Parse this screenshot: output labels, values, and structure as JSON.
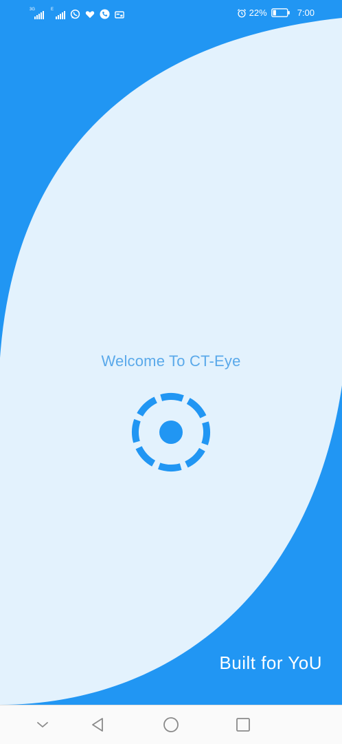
{
  "status_bar": {
    "network_1_label": "3G",
    "network_2_label": "E",
    "battery_percent": "22%",
    "time": "7:00",
    "battery_level": 0.22,
    "icons": [
      "signal-icon",
      "signal-icon",
      "whatsapp-icon",
      "heart-icon",
      "phone-icon",
      "card-icon",
      "alarm-icon",
      "battery-icon"
    ]
  },
  "splash": {
    "welcome_text": "Welcome To CT-Eye",
    "tagline": "Built for YoU",
    "logo_icon": "eye-target-icon"
  },
  "navigation": {
    "buttons": [
      "collapse-icon",
      "back-icon",
      "home-icon",
      "recents-icon"
    ]
  },
  "colors": {
    "primary": "#2196f3",
    "surface": "#e3f2fd",
    "welcome_text": "#5aa9ea",
    "nav_background": "#fafafa",
    "nav_icon": "#8a8a8a"
  }
}
